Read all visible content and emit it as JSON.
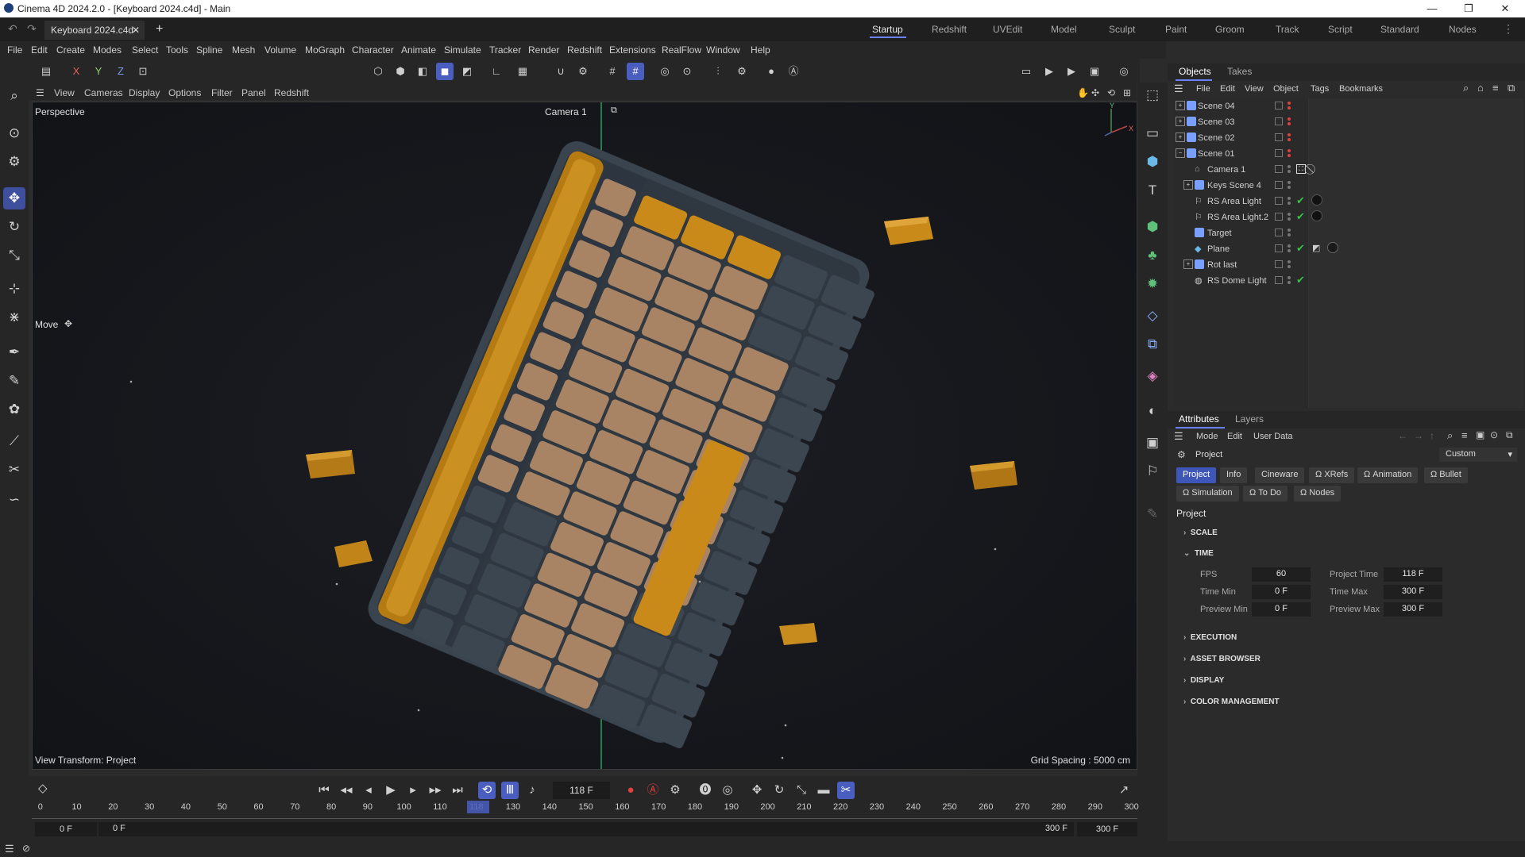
{
  "window": {
    "title": "Cinema 4D 2024.2.0 - [Keyboard 2024.c4d] - Main"
  },
  "doc_tab": {
    "label": "Keyboard 2024.c4d"
  },
  "layouts": [
    "Startup",
    "Redshift",
    "UVEdit",
    "Model",
    "Sculpt",
    "Paint",
    "Groom",
    "Track",
    "Script",
    "Standard",
    "Nodes"
  ],
  "menu": [
    "File",
    "Edit",
    "Create",
    "Modes",
    "Select",
    "Tools",
    "Spline",
    "Mesh",
    "Volume",
    "MoGraph",
    "Character",
    "Animate",
    "Simulate",
    "Tracker",
    "Render",
    "Redshift",
    "Extensions",
    "RealFlow",
    "Window",
    "Help"
  ],
  "toolbar": {
    "axes": [
      "X",
      "Y",
      "Z"
    ]
  },
  "viewport_menu": [
    "View",
    "Cameras",
    "Display",
    "Options",
    "Filter",
    "Panel",
    "Redshift"
  ],
  "viewport": {
    "name": "Perspective",
    "camera": "Camera 1",
    "tool": "Move",
    "view_transform": "View Transform: Project",
    "grid_spacing": "Grid Spacing : 5000 cm",
    "axis_y": "Y",
    "axis_x": "X"
  },
  "objects_panel": {
    "tabs": [
      "Objects",
      "Takes"
    ],
    "menu": [
      "File",
      "Edit",
      "View",
      "Object",
      "Tags",
      "Bookmarks"
    ],
    "items": [
      {
        "name": "Scene 04",
        "level": 0
      },
      {
        "name": "Scene 03",
        "level": 0
      },
      {
        "name": "Scene 02",
        "level": 0
      },
      {
        "name": "Scene 01",
        "level": 0
      },
      {
        "name": "Camera 1",
        "level": 1
      },
      {
        "name": "Keys Scene 4",
        "level": 1
      },
      {
        "name": "RS Area Light",
        "level": 1
      },
      {
        "name": "RS Area Light.2",
        "level": 1
      },
      {
        "name": "Target",
        "level": 1
      },
      {
        "name": "Plane",
        "level": 1
      },
      {
        "name": "Rot last",
        "level": 1
      },
      {
        "name": "RS Dome Light",
        "level": 1
      }
    ]
  },
  "attributes_panel": {
    "tabs": [
      "Attributes",
      "Layers"
    ],
    "menu": [
      "Mode",
      "Edit",
      "User Data"
    ],
    "object": "Project",
    "preset": "Custom",
    "buttons_row1": [
      "Project",
      "Info",
      "Cineware",
      "XRefs",
      "Animation",
      "Bullet"
    ],
    "buttons_row2": [
      "Simulation",
      "To Do",
      "Nodes"
    ],
    "title": "Project",
    "sections": [
      "SCALE",
      "TIME",
      "EXECUTION",
      "ASSET BROWSER",
      "DISPLAY",
      "COLOR MANAGEMENT"
    ],
    "time": {
      "fps_label": "FPS",
      "fps": "60",
      "project_time_label": "Project Time",
      "project_time": "118 F",
      "time_min_label": "Time Min",
      "time_min": "0 F",
      "time_max_label": "Time Max",
      "time_max": "300 F",
      "preview_min_label": "Preview Min",
      "preview_min": "0 F",
      "preview_max_label": "Preview Max",
      "preview_max": "300 F"
    }
  },
  "timeline": {
    "current_frame": "118 F",
    "ticks": [
      "0",
      "10",
      "20",
      "30",
      "40",
      "50",
      "60",
      "70",
      "80",
      "90",
      "100",
      "110",
      "118",
      "130",
      "140",
      "150",
      "160",
      "170",
      "180",
      "190",
      "200",
      "210",
      "220",
      "230",
      "240",
      "250",
      "260",
      "270",
      "280",
      "290",
      "300"
    ],
    "start_a": "0 F",
    "start_b": "0 F",
    "end_a": "300 F",
    "end_b": "300 F"
  },
  "colors": {
    "accent": "#4a5ec0",
    "keycap_orange": "#c98a1a",
    "keycap_tan": "#a88464",
    "keycap_slate": "#3b4651",
    "green": "#37c24a",
    "red": "#e04040"
  }
}
